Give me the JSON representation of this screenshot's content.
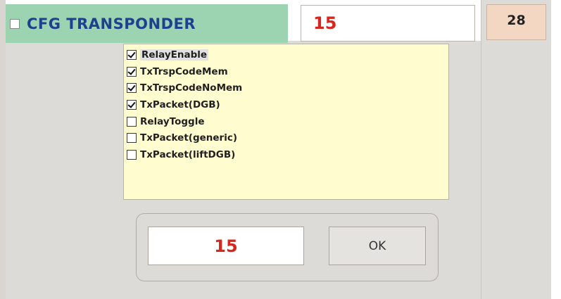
{
  "header": {
    "title": "CFG TRANSPONDER",
    "checked": false
  },
  "top_value": "15",
  "right_value": "28",
  "checklist": [
    {
      "label": "RelayEnable",
      "checked": true
    },
    {
      "label": "TxTrspCodeMem",
      "checked": true
    },
    {
      "label": "TxTrspCodeNoMem",
      "checked": true
    },
    {
      "label": "TxPacket(DGB)",
      "checked": true
    },
    {
      "label": "RelayToggle",
      "checked": false
    },
    {
      "label": "TxPacket(generic)",
      "checked": false
    },
    {
      "label": "TxPacket(liftDGB)",
      "checked": false
    }
  ],
  "bottom": {
    "value": "15",
    "ok_label": "OK"
  },
  "colors": {
    "header_bg": "#9cd3b0",
    "header_text": "#1f3f8f",
    "value_red": "#d7261e",
    "right_value_bg": "#f4d7c2",
    "checklist_bg": "#fffcd0"
  }
}
